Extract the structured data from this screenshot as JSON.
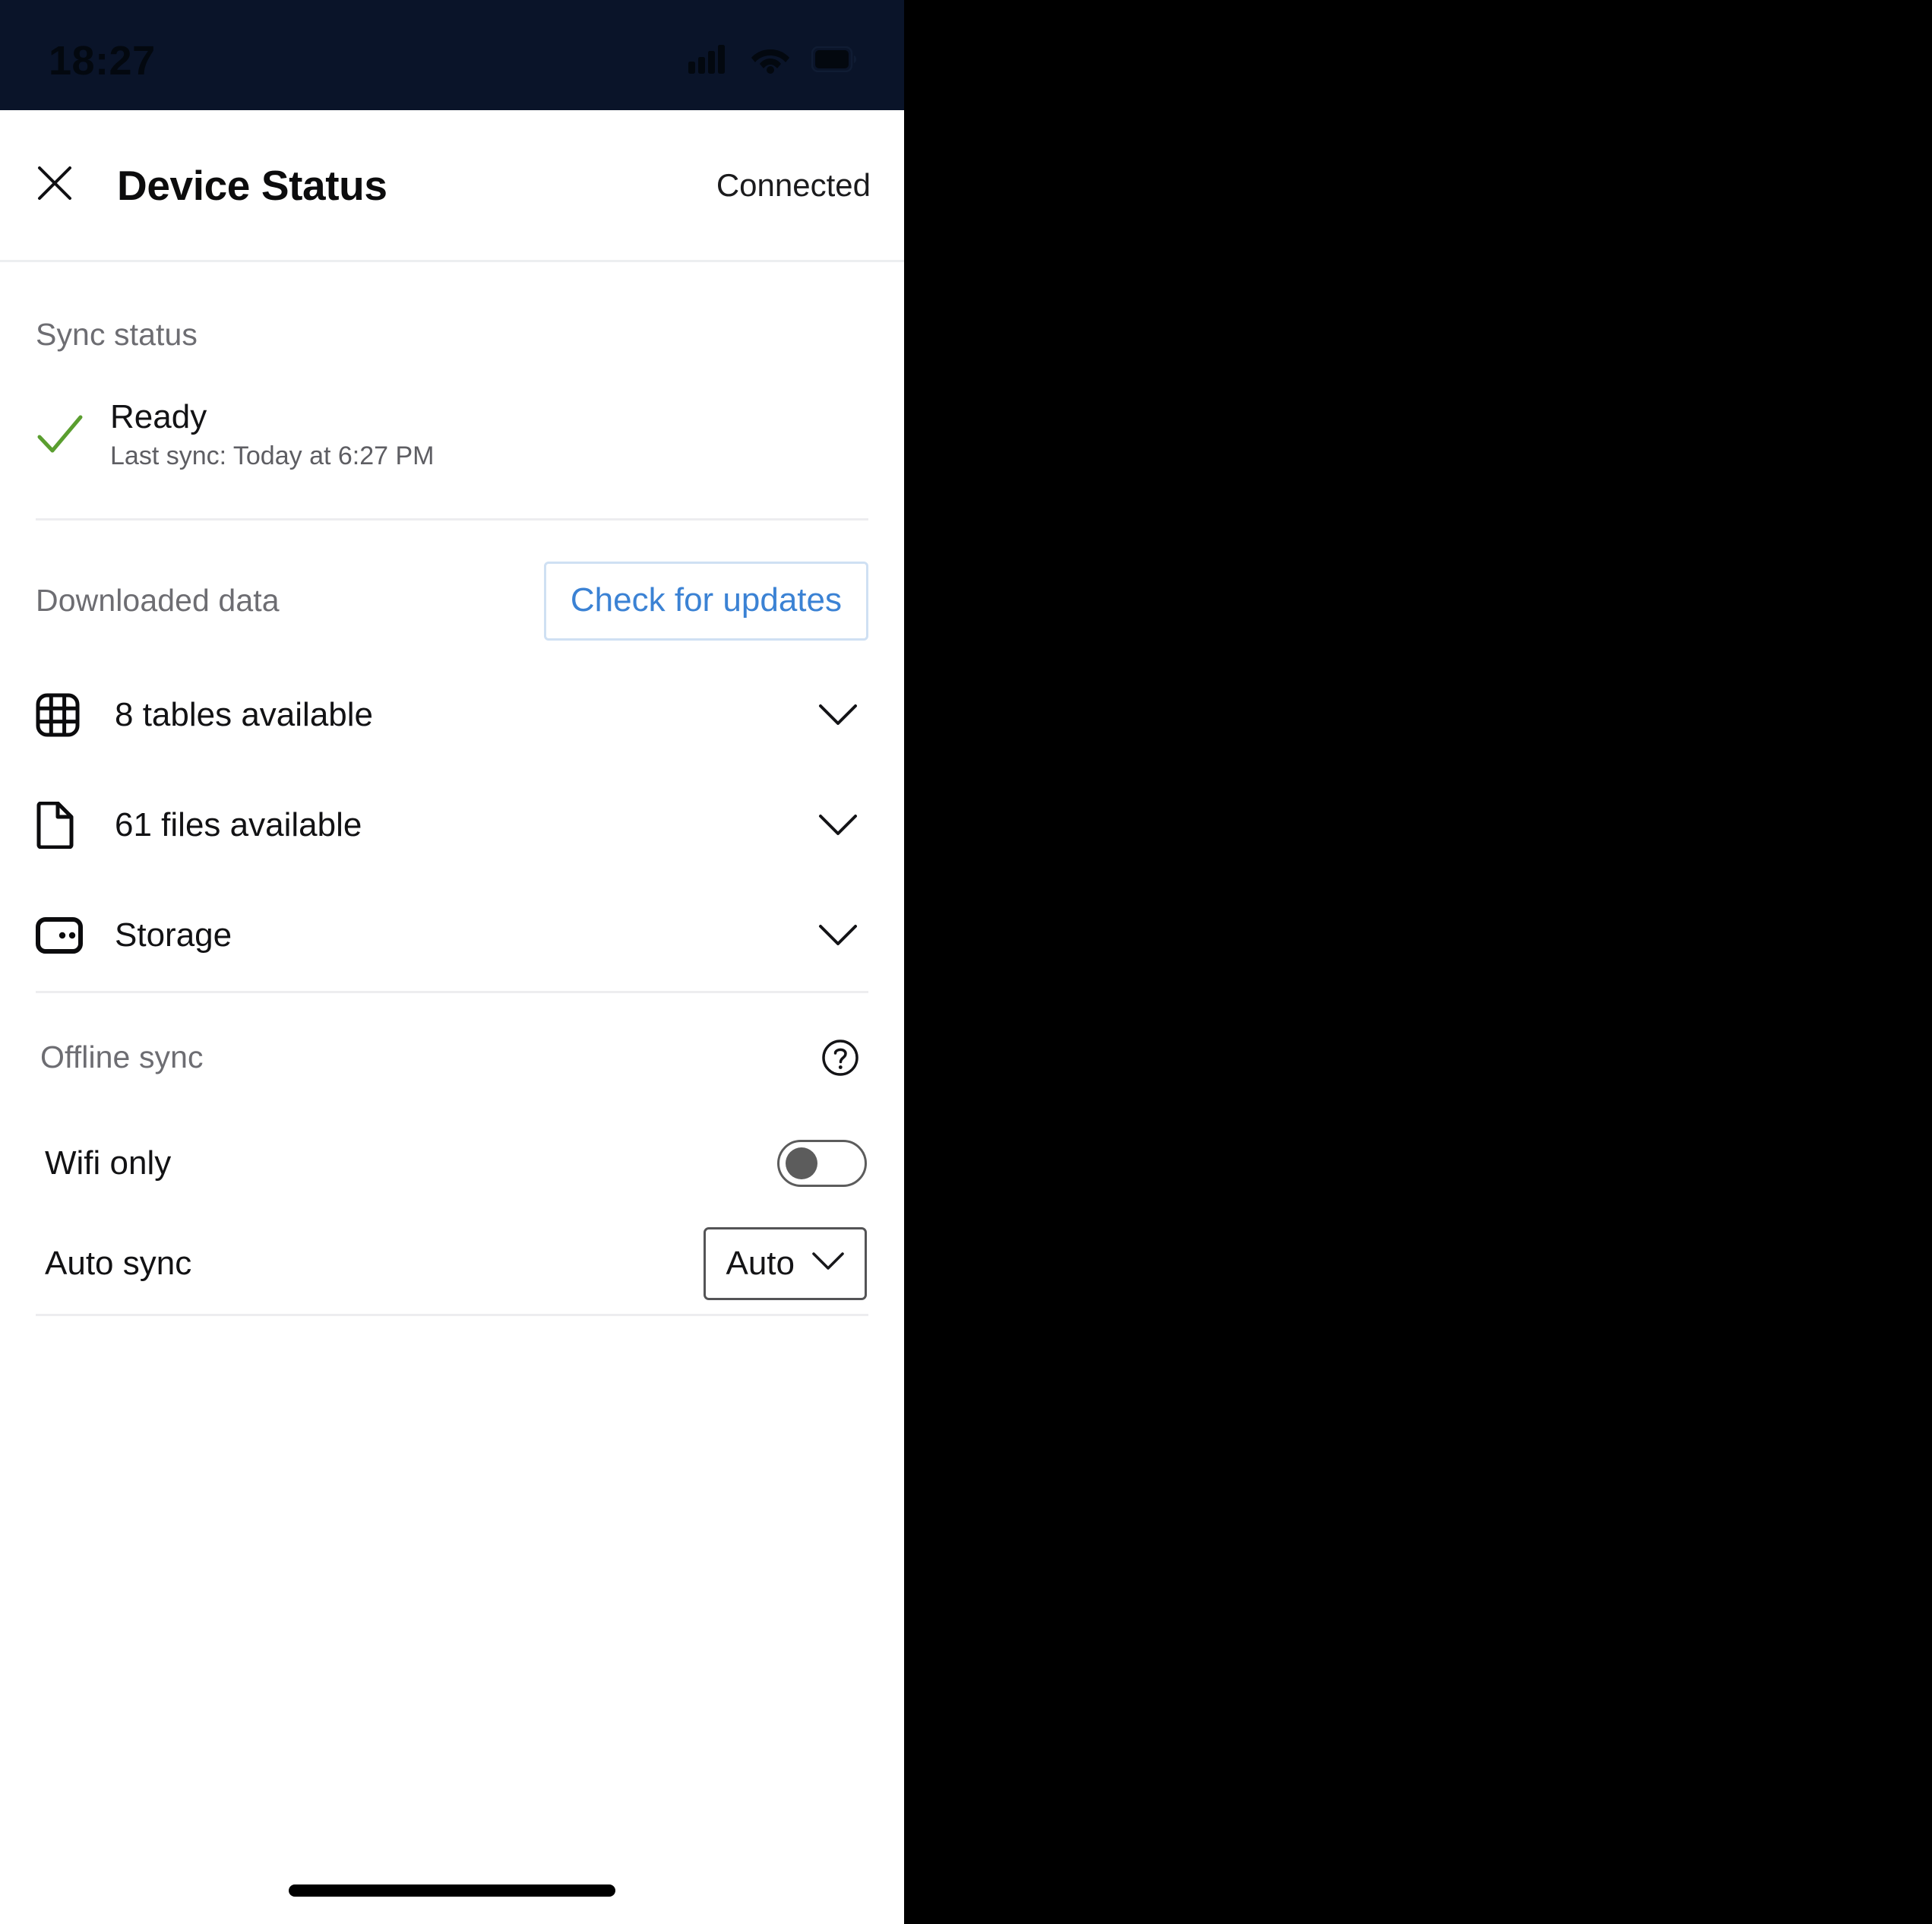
{
  "status_bar": {
    "time": "18:27",
    "icons": [
      "cellular-signal-icon",
      "wifi-icon",
      "battery-icon"
    ]
  },
  "header": {
    "close_icon": "close-icon",
    "title": "Device Status",
    "connection_status": "Connected"
  },
  "sync_section": {
    "label": "Sync status",
    "state_icon": "check-icon",
    "state": "Ready",
    "last_sync": "Last sync: Today at 6:27 PM"
  },
  "downloaded_section": {
    "label": "Downloaded data",
    "check_updates_label": "Check for updates",
    "rows": [
      {
        "icon": "table-grid-icon",
        "label": "8 tables available",
        "chevron": "chevron-down-icon"
      },
      {
        "icon": "file-document-icon",
        "label": "61 files available",
        "chevron": "chevron-down-icon"
      },
      {
        "icon": "storage-drive-icon",
        "label": "Storage",
        "chevron": "chevron-down-icon"
      }
    ]
  },
  "offline_section": {
    "label": "Offline sync",
    "help_icon": "help-circle-icon",
    "wifi_only": {
      "label": "Wifi only",
      "toggle_state": "off"
    },
    "auto_sync": {
      "label": "Auto sync",
      "value": "Auto",
      "chevron": "chevron-down-icon"
    }
  },
  "colors": {
    "status_bar_bg": "#0a1429",
    "accent_blue": "#3b82d4",
    "accent_blue_border": "#cfe0f3",
    "success_green": "#5a9e2f",
    "muted_text": "#6d6d72",
    "divider": "#ededef"
  }
}
